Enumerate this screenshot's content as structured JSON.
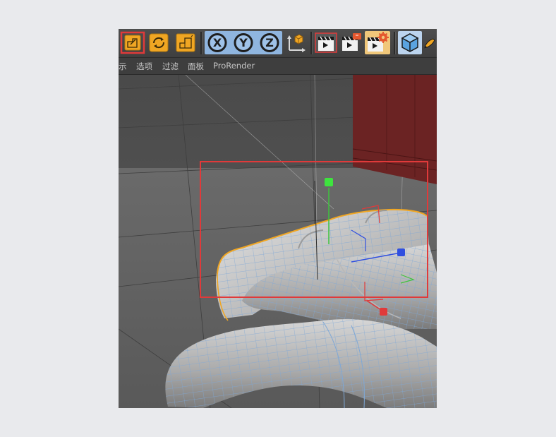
{
  "toolbar": {
    "buttons": [
      {
        "name": "scale-tool-button",
        "icon": "scale-icon",
        "active": true
      },
      {
        "name": "rotate-tool-button",
        "icon": "rotate-icon"
      },
      {
        "name": "scale-object-button",
        "icon": "scale-icon"
      },
      {
        "name": "x-axis-lock-button",
        "label": "X"
      },
      {
        "name": "y-axis-lock-button",
        "label": "Y"
      },
      {
        "name": "z-axis-lock-button",
        "label": "Z"
      },
      {
        "name": "coordinate-system-button",
        "icon": "axis-coordinate-icon"
      },
      {
        "name": "render-view-button",
        "icon": "clapperboard-icon"
      },
      {
        "name": "render-picture-viewer-button",
        "icon": "clapperboard-icon"
      },
      {
        "name": "render-settings-button",
        "icon": "clapperboard-gear-icon"
      },
      {
        "name": "cube-primitive-button",
        "icon": "cube-icon"
      },
      {
        "name": "pen-tool-button",
        "icon": "pen-icon"
      }
    ],
    "colors": {
      "accent_orange": "#f0a623",
      "axis_blue": "#7eb3e6",
      "highlight_red": "#e03a3a"
    }
  },
  "menubar": {
    "items": [
      "示",
      "选项",
      "过滤",
      "面板",
      "ProRender"
    ]
  }
}
